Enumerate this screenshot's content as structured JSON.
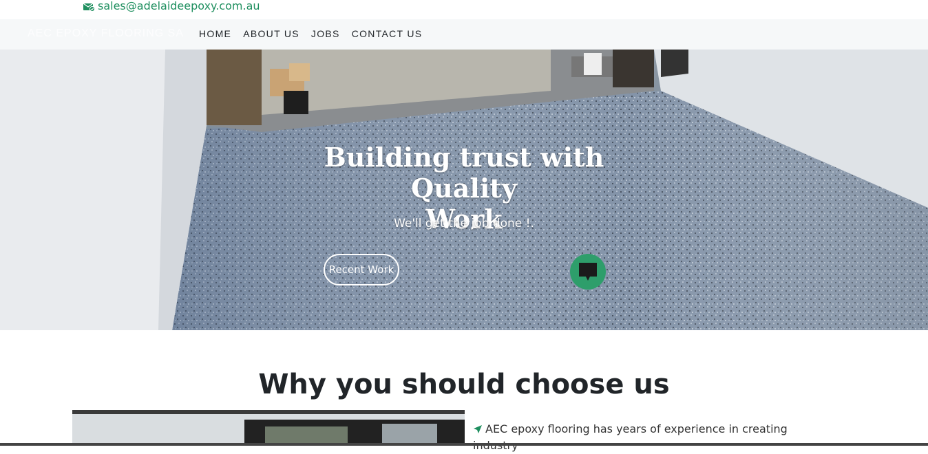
{
  "topbar": {
    "email": "sales@adelaideepoxy.com.au",
    "email_icon": "envelope-check-icon"
  },
  "navbar": {
    "brand": "AEC EPOXY FLOORING SA",
    "items": [
      {
        "label": "HOME"
      },
      {
        "label": "ABOUT US"
      },
      {
        "label": "JOBS"
      },
      {
        "label": "CONTACT US"
      }
    ]
  },
  "hero": {
    "title_line1": "Building trust with Quality",
    "title_line2": "Work",
    "subtitle": "We'll get the job done !.",
    "button_label": "Recent Work",
    "chat_icon": "chat-bubble-icon"
  },
  "why": {
    "title": "Why you should choose us",
    "point_1": "AEC epoxy flooring has years of experience in creating industry",
    "bullet_icon": "location-arrow-icon"
  },
  "colors": {
    "accent_green": "#1f8f5f",
    "chat_green": "#2e9e6b",
    "nav_bg": "#f6f8f9",
    "heading": "#212529"
  }
}
